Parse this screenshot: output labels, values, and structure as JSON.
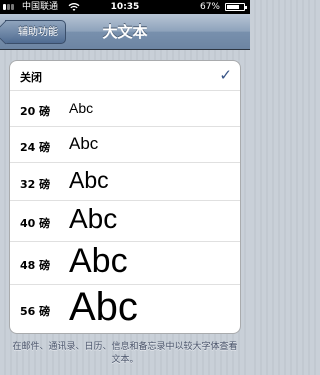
{
  "status_bar": {
    "carrier": "中国联通",
    "time": "10:35",
    "battery_percent": "67%",
    "battery_level": 0.67
  },
  "nav": {
    "title": "大文本",
    "back_label": "辅助功能"
  },
  "options": {
    "off": {
      "label": "关闭",
      "checkmark": "✓",
      "selected": true
    },
    "sizes": [
      {
        "label": "20 磅",
        "sample": "Abc"
      },
      {
        "label": "24 磅",
        "sample": "Abc"
      },
      {
        "label": "32 磅",
        "sample": "Abc"
      },
      {
        "label": "40 磅",
        "sample": "Abc"
      },
      {
        "label": "48 磅",
        "sample": "Abc"
      },
      {
        "label": "56 磅",
        "sample": "Abc"
      }
    ]
  },
  "footer_note": "在邮件、通讯录、日历、信息和备忘录中以较大字体查看文本。",
  "colors": {
    "nav_bar": "#6d85a3",
    "background": "#c5ccd4",
    "checkmark": "#385487"
  }
}
